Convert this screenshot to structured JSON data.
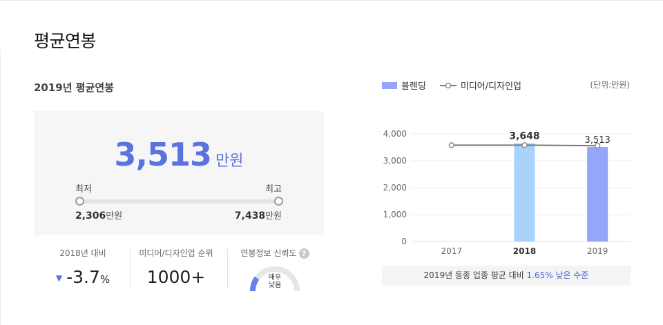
{
  "page_title": "평균연봉",
  "section_title": "2019년 평균연봉",
  "summary": {
    "value": "3,513",
    "unit": "만원",
    "min_label": "최저",
    "max_label": "최고",
    "min_value": "2,306",
    "max_value": "7,438",
    "value_unit": "만원"
  },
  "stats": {
    "change_label": "2018년 대비",
    "change_value": "-3.7",
    "change_pct": "%",
    "rank_label": "미디어/디자인업 순위",
    "rank_value": "1000+",
    "trust_label": "연봉정보 신뢰도",
    "trust_help": "?",
    "trust_level_line1": "매우",
    "trust_level_line2": "낮음"
  },
  "legend": {
    "bar_label": "블렌딩",
    "line_label": "미디어/디자인업",
    "unit_note": "(단위:만원)"
  },
  "chart_data": {
    "type": "bar",
    "categories": [
      "2017",
      "2018",
      "2019"
    ],
    "series": [
      {
        "name": "블렌딩",
        "type": "bar",
        "values": [
          null,
          3648,
          3513
        ],
        "value_labels": [
          "",
          "3,648",
          "3,513"
        ]
      },
      {
        "name": "미디어/디자인업",
        "type": "line",
        "values": [
          3580,
          3580,
          3560
        ]
      }
    ],
    "yticks": [
      "4,000",
      "3,000",
      "2,000",
      "1,000",
      "0"
    ],
    "ylim": [
      0,
      4000
    ],
    "colors": {
      "bar_2018": "#a9d3fb",
      "bar_2019": "#95a5f7",
      "line": "#777777"
    }
  },
  "chart_note": {
    "prefix": "2019년 동종 업종 평균 대비 ",
    "highlight": "1.65% 낮은 수준"
  }
}
